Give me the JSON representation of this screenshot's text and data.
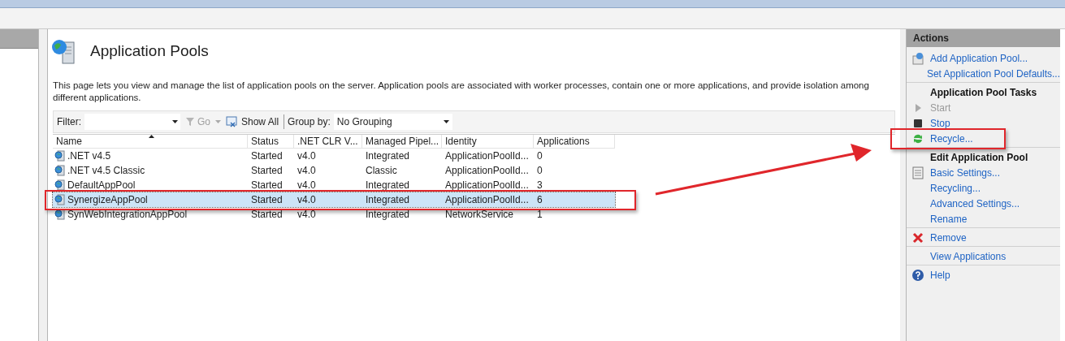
{
  "page": {
    "title": "Application Pools",
    "description": "This page lets you view and manage the list of application pools on the server. Application pools are associated with worker processes, contain one or more applications, and provide isolation among different applications."
  },
  "toolbar": {
    "filter_label": "Filter:",
    "go": "Go",
    "show_all": "Show All",
    "group_by_label": "Group by:",
    "group_by_value": "No Grouping"
  },
  "table": {
    "columns": [
      {
        "label": "Name",
        "sorted": true
      },
      {
        "label": "Status",
        "sorted": false
      },
      {
        "label": ".NET CLR V...",
        "sorted": false
      },
      {
        "label": "Managed Pipel...",
        "sorted": false
      },
      {
        "label": "Identity",
        "sorted": false
      },
      {
        "label": "Applications",
        "sorted": false
      }
    ],
    "rows": [
      {
        "cells": [
          ".NET v4.5",
          "Started",
          "v4.0",
          "Integrated",
          "ApplicationPoolId...",
          "0"
        ],
        "selected": false,
        "annotated": false
      },
      {
        "cells": [
          ".NET v4.5 Classic",
          "Started",
          "v4.0",
          "Classic",
          "ApplicationPoolId...",
          "0"
        ],
        "selected": false,
        "annotated": false
      },
      {
        "cells": [
          "DefaultAppPool",
          "Started",
          "v4.0",
          "Integrated",
          "ApplicationPoolId...",
          "3"
        ],
        "selected": false,
        "annotated": false
      },
      {
        "cells": [
          "SynergizeAppPool",
          "Started",
          "v4.0",
          "Integrated",
          "ApplicationPoolId...",
          "6"
        ],
        "selected": true,
        "annotated": true
      },
      {
        "cells": [
          "SynWebIntegrationAppPool",
          "Started",
          "v4.0",
          "Integrated",
          "NetworkService",
          "1"
        ],
        "selected": false,
        "annotated": false
      }
    ]
  },
  "actions": {
    "title": "Actions",
    "items": [
      {
        "kind": "add",
        "label": "Add Application Pool...",
        "disabled": false,
        "divider_after": false,
        "annotated": false
      },
      {
        "kind": "link",
        "label": "Set Application Pool Defaults...",
        "disabled": false,
        "divider_after": true,
        "annotated": false
      },
      {
        "kind": "section",
        "label": "Application Pool Tasks",
        "disabled": false,
        "divider_after": false,
        "annotated": false
      },
      {
        "kind": "start",
        "label": "Start",
        "disabled": true,
        "divider_after": false,
        "annotated": false
      },
      {
        "kind": "stop",
        "label": "Stop",
        "disabled": false,
        "divider_after": false,
        "annotated": false
      },
      {
        "kind": "recycle",
        "label": "Recycle...",
        "disabled": false,
        "divider_after": true,
        "annotated": true
      },
      {
        "kind": "section",
        "label": "Edit Application Pool",
        "disabled": false,
        "divider_after": false,
        "annotated": false
      },
      {
        "kind": "settings",
        "label": "Basic Settings...",
        "disabled": false,
        "divider_after": false,
        "annotated": false
      },
      {
        "kind": "link",
        "label": "Recycling...",
        "disabled": false,
        "divider_after": false,
        "annotated": false
      },
      {
        "kind": "link",
        "label": "Advanced Settings...",
        "disabled": false,
        "divider_after": false,
        "annotated": false
      },
      {
        "kind": "link",
        "label": "Rename",
        "disabled": false,
        "divider_after": true,
        "annotated": false
      },
      {
        "kind": "remove",
        "label": "Remove",
        "disabled": false,
        "divider_after": true,
        "annotated": false
      },
      {
        "kind": "link",
        "label": "View Applications",
        "disabled": false,
        "divider_after": true,
        "annotated": false
      },
      {
        "kind": "help",
        "label": "Help",
        "disabled": false,
        "divider_after": false,
        "annotated": false
      }
    ]
  }
}
